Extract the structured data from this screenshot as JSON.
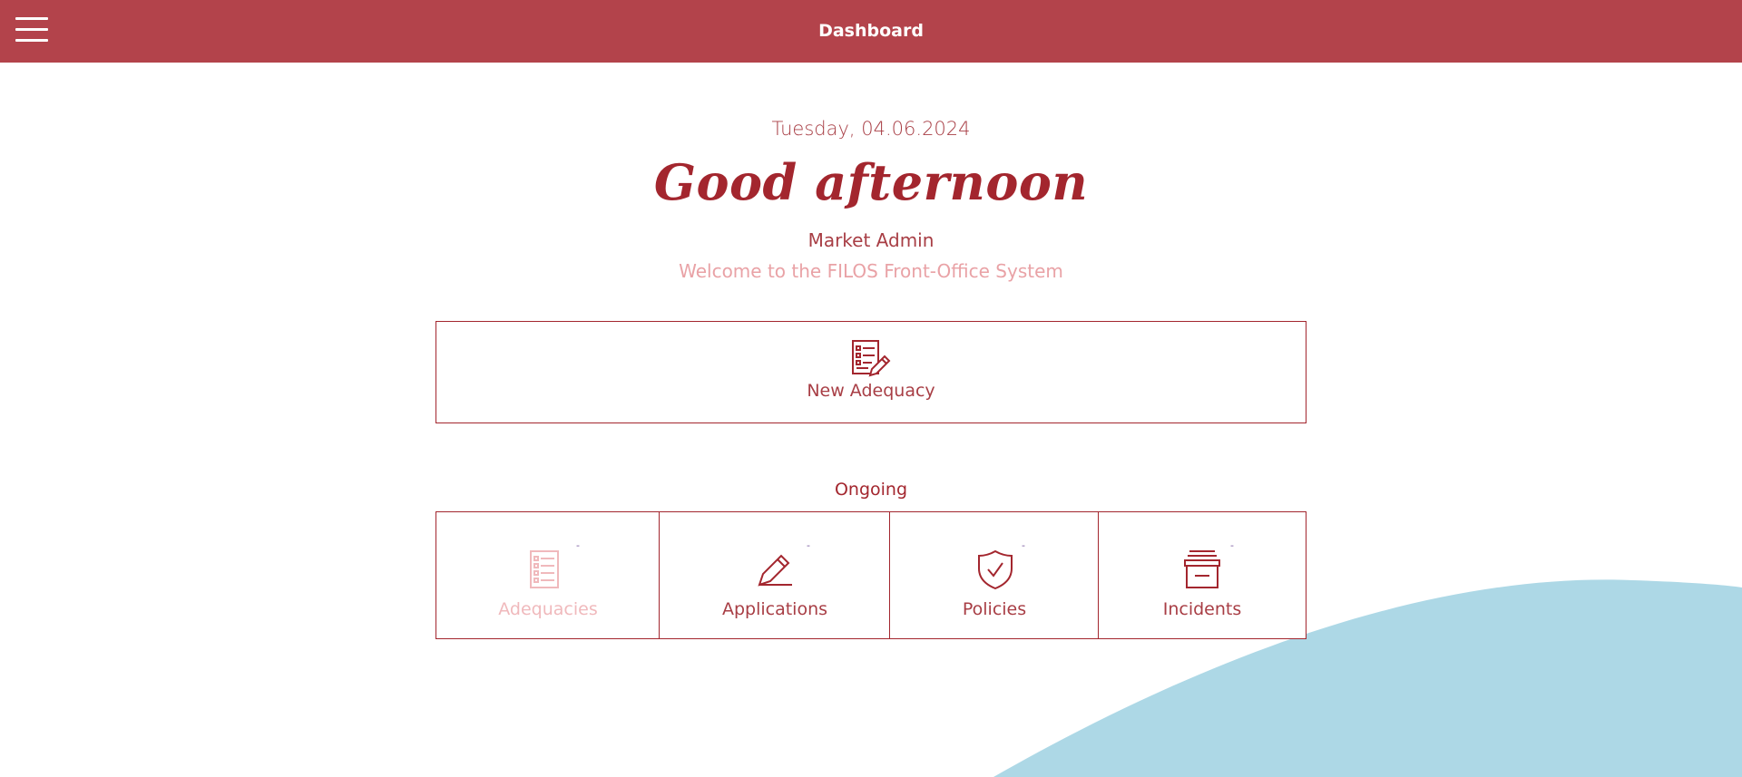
{
  "header": {
    "title": "Dashboard",
    "menu_icon": "hamburger-icon"
  },
  "welcome_panel": {
    "date": "Tuesday, 04.06.2024",
    "greeting": "Good afternoon",
    "user_name": "Market Admin",
    "welcome_message": "Welcome to the FILOS Front-Office System"
  },
  "new_adequacy": {
    "label": "New Adequacy",
    "icon": "checklist-edit-icon"
  },
  "ongoing": {
    "title": "Ongoing",
    "tiles": [
      {
        "label": "Adequacies",
        "icon": "checklist-icon",
        "badge": "-",
        "enabled": false
      },
      {
        "label": "Applications",
        "icon": "pencil-icon",
        "badge": "-",
        "enabled": true
      },
      {
        "label": "Policies",
        "icon": "shield-check-icon",
        "badge": "-",
        "enabled": true
      },
      {
        "label": "Incidents",
        "icon": "archive-box-icon",
        "badge": "-",
        "enabled": true
      }
    ]
  },
  "colors": {
    "brand": "#b3434b",
    "primary_text": "#a3262e",
    "muted_text": "#e9a2a6",
    "disabled": "#f0b9bc",
    "accent_wave": "#add8e6"
  }
}
